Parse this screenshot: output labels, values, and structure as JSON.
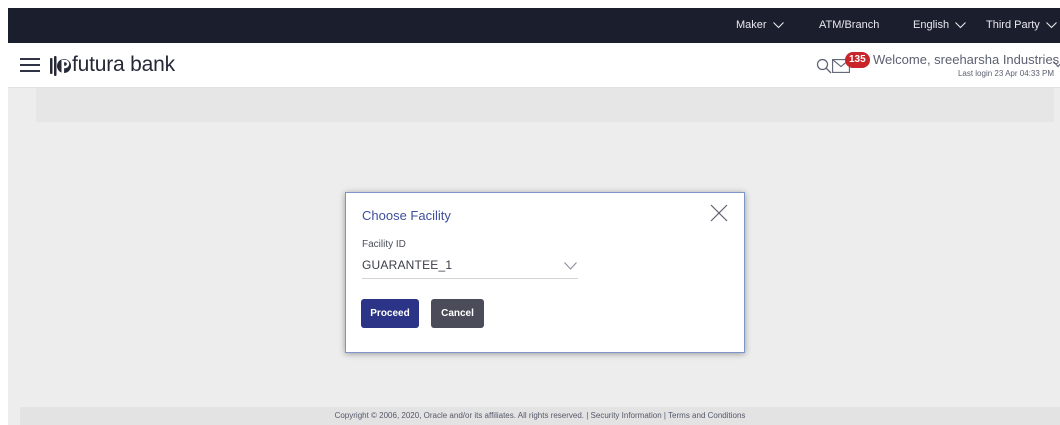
{
  "topbar": {
    "role_label": "Maker",
    "location_label": "ATM/Branch",
    "language_label": "English",
    "party_label": "Third Party"
  },
  "header": {
    "bank_name": "futura bank",
    "mail_count": "135",
    "welcome_text": "Welcome, sreeharsha Industries",
    "last_login": "Last login 23 Apr 04:33 PM"
  },
  "modal": {
    "title": "Choose Facility",
    "field_label": "Facility ID",
    "selected_value": "GUARANTEE_1",
    "proceed_label": "Proceed",
    "cancel_label": "Cancel"
  },
  "footer": {
    "text": "Copyright © 2006, 2020, Oracle and/or its affiliates. All rights reserved. | Security Information | Terms and Conditions"
  },
  "colors": {
    "topbar_bg": "#1b1e2c",
    "primary_button": "#2b3486",
    "secondary_button": "#4a4c59",
    "badge": "#c8242a",
    "modal_title": "#3e4e9a"
  },
  "icons": {
    "menu": "hamburger-icon",
    "logo": "futura-logo-icon",
    "search": "search-icon",
    "mail": "mail-icon",
    "close": "close-icon",
    "dropdown": "chevron-down-icon"
  }
}
